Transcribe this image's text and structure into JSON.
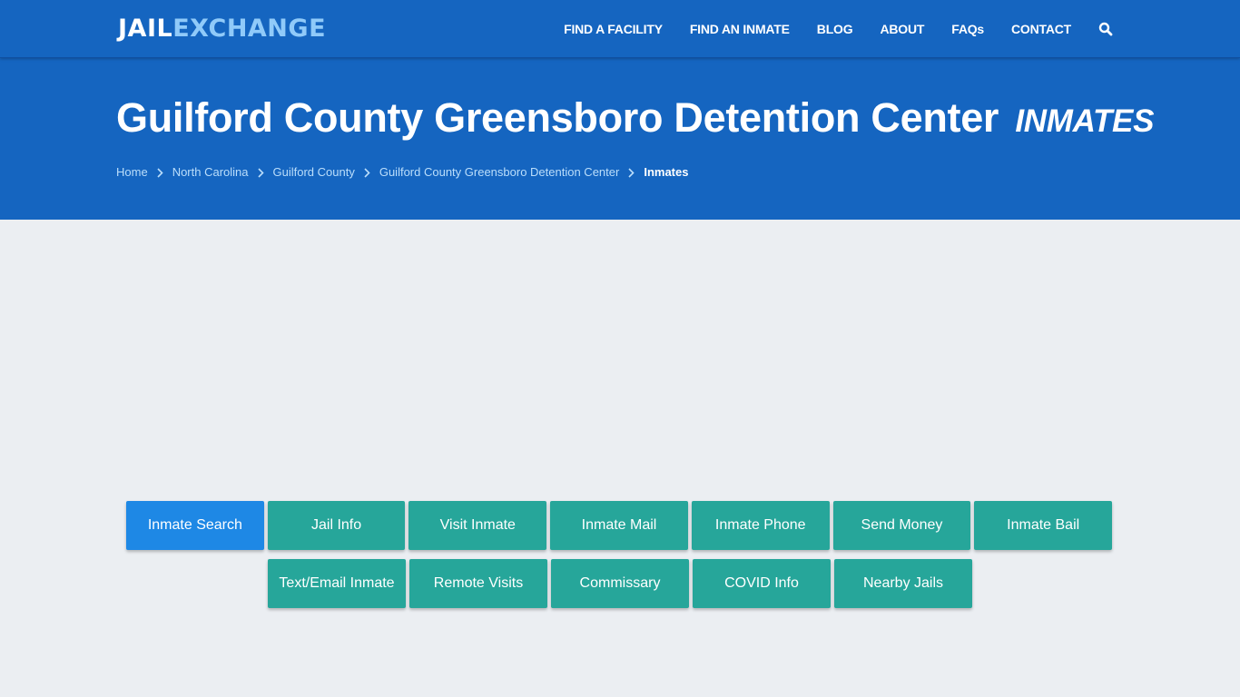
{
  "header": {
    "logo": {
      "part1": "JAIL",
      "part2": "EXCHANGE"
    },
    "nav": [
      {
        "label": "FIND A FACILITY"
      },
      {
        "label": "FIND AN INMATE"
      },
      {
        "label": "BLOG"
      },
      {
        "label": "ABOUT"
      },
      {
        "label": "FAQs"
      },
      {
        "label": "CONTACT"
      }
    ],
    "search_icon": "search-icon"
  },
  "hero": {
    "title": "Guilford County Greensboro Detention Center",
    "subtitle": "INMATES",
    "breadcrumb": [
      {
        "label": "Home"
      },
      {
        "label": "North Carolina"
      },
      {
        "label": "Guilford County"
      },
      {
        "label": "Guilford County Greensboro Detention Center"
      },
      {
        "label": "Inmates"
      }
    ]
  },
  "buttons": {
    "row1": [
      {
        "label": "Inmate Search",
        "active": true
      },
      {
        "label": "Jail Info"
      },
      {
        "label": "Visit Inmate"
      },
      {
        "label": "Inmate Mail"
      },
      {
        "label": "Inmate Phone"
      },
      {
        "label": "Send Money"
      },
      {
        "label": "Inmate Bail"
      }
    ],
    "row2": [
      {
        "label": "Text/Email Inmate"
      },
      {
        "label": "Remote Visits"
      },
      {
        "label": "Commissary"
      },
      {
        "label": "COVID Info"
      },
      {
        "label": "Nearby Jails"
      }
    ]
  },
  "colors": {
    "brand_blue": "#1565c0",
    "logo_accent": "#90caf9",
    "active_button": "#1e88e5",
    "button_teal": "#26a69a",
    "page_bg": "#ebeef2"
  }
}
